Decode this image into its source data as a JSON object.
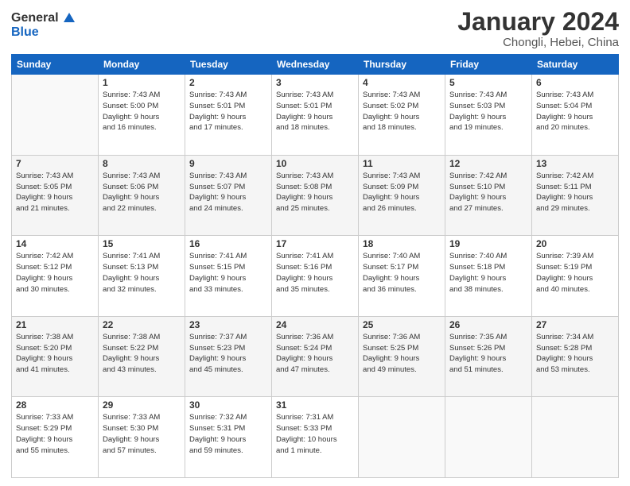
{
  "logo": {
    "line1": "General",
    "line2": "Blue"
  },
  "title": "January 2024",
  "subtitle": "Chongli, Hebei, China",
  "days_header": [
    "Sunday",
    "Monday",
    "Tuesday",
    "Wednesday",
    "Thursday",
    "Friday",
    "Saturday"
  ],
  "weeks": [
    [
      {
        "num": "",
        "info": ""
      },
      {
        "num": "1",
        "info": "Sunrise: 7:43 AM\nSunset: 5:00 PM\nDaylight: 9 hours\nand 16 minutes."
      },
      {
        "num": "2",
        "info": "Sunrise: 7:43 AM\nSunset: 5:01 PM\nDaylight: 9 hours\nand 17 minutes."
      },
      {
        "num": "3",
        "info": "Sunrise: 7:43 AM\nSunset: 5:01 PM\nDaylight: 9 hours\nand 18 minutes."
      },
      {
        "num": "4",
        "info": "Sunrise: 7:43 AM\nSunset: 5:02 PM\nDaylight: 9 hours\nand 18 minutes."
      },
      {
        "num": "5",
        "info": "Sunrise: 7:43 AM\nSunset: 5:03 PM\nDaylight: 9 hours\nand 19 minutes."
      },
      {
        "num": "6",
        "info": "Sunrise: 7:43 AM\nSunset: 5:04 PM\nDaylight: 9 hours\nand 20 minutes."
      }
    ],
    [
      {
        "num": "7",
        "info": "Sunrise: 7:43 AM\nSunset: 5:05 PM\nDaylight: 9 hours\nand 21 minutes."
      },
      {
        "num": "8",
        "info": "Sunrise: 7:43 AM\nSunset: 5:06 PM\nDaylight: 9 hours\nand 22 minutes."
      },
      {
        "num": "9",
        "info": "Sunrise: 7:43 AM\nSunset: 5:07 PM\nDaylight: 9 hours\nand 24 minutes."
      },
      {
        "num": "10",
        "info": "Sunrise: 7:43 AM\nSunset: 5:08 PM\nDaylight: 9 hours\nand 25 minutes."
      },
      {
        "num": "11",
        "info": "Sunrise: 7:43 AM\nSunset: 5:09 PM\nDaylight: 9 hours\nand 26 minutes."
      },
      {
        "num": "12",
        "info": "Sunrise: 7:42 AM\nSunset: 5:10 PM\nDaylight: 9 hours\nand 27 minutes."
      },
      {
        "num": "13",
        "info": "Sunrise: 7:42 AM\nSunset: 5:11 PM\nDaylight: 9 hours\nand 29 minutes."
      }
    ],
    [
      {
        "num": "14",
        "info": "Sunrise: 7:42 AM\nSunset: 5:12 PM\nDaylight: 9 hours\nand 30 minutes."
      },
      {
        "num": "15",
        "info": "Sunrise: 7:41 AM\nSunset: 5:13 PM\nDaylight: 9 hours\nand 32 minutes."
      },
      {
        "num": "16",
        "info": "Sunrise: 7:41 AM\nSunset: 5:15 PM\nDaylight: 9 hours\nand 33 minutes."
      },
      {
        "num": "17",
        "info": "Sunrise: 7:41 AM\nSunset: 5:16 PM\nDaylight: 9 hours\nand 35 minutes."
      },
      {
        "num": "18",
        "info": "Sunrise: 7:40 AM\nSunset: 5:17 PM\nDaylight: 9 hours\nand 36 minutes."
      },
      {
        "num": "19",
        "info": "Sunrise: 7:40 AM\nSunset: 5:18 PM\nDaylight: 9 hours\nand 38 minutes."
      },
      {
        "num": "20",
        "info": "Sunrise: 7:39 AM\nSunset: 5:19 PM\nDaylight: 9 hours\nand 40 minutes."
      }
    ],
    [
      {
        "num": "21",
        "info": "Sunrise: 7:38 AM\nSunset: 5:20 PM\nDaylight: 9 hours\nand 41 minutes."
      },
      {
        "num": "22",
        "info": "Sunrise: 7:38 AM\nSunset: 5:22 PM\nDaylight: 9 hours\nand 43 minutes."
      },
      {
        "num": "23",
        "info": "Sunrise: 7:37 AM\nSunset: 5:23 PM\nDaylight: 9 hours\nand 45 minutes."
      },
      {
        "num": "24",
        "info": "Sunrise: 7:36 AM\nSunset: 5:24 PM\nDaylight: 9 hours\nand 47 minutes."
      },
      {
        "num": "25",
        "info": "Sunrise: 7:36 AM\nSunset: 5:25 PM\nDaylight: 9 hours\nand 49 minutes."
      },
      {
        "num": "26",
        "info": "Sunrise: 7:35 AM\nSunset: 5:26 PM\nDaylight: 9 hours\nand 51 minutes."
      },
      {
        "num": "27",
        "info": "Sunrise: 7:34 AM\nSunset: 5:28 PM\nDaylight: 9 hours\nand 53 minutes."
      }
    ],
    [
      {
        "num": "28",
        "info": "Sunrise: 7:33 AM\nSunset: 5:29 PM\nDaylight: 9 hours\nand 55 minutes."
      },
      {
        "num": "29",
        "info": "Sunrise: 7:33 AM\nSunset: 5:30 PM\nDaylight: 9 hours\nand 57 minutes."
      },
      {
        "num": "30",
        "info": "Sunrise: 7:32 AM\nSunset: 5:31 PM\nDaylight: 9 hours\nand 59 minutes."
      },
      {
        "num": "31",
        "info": "Sunrise: 7:31 AM\nSunset: 5:33 PM\nDaylight: 10 hours\nand 1 minute."
      },
      {
        "num": "",
        "info": ""
      },
      {
        "num": "",
        "info": ""
      },
      {
        "num": "",
        "info": ""
      }
    ]
  ]
}
